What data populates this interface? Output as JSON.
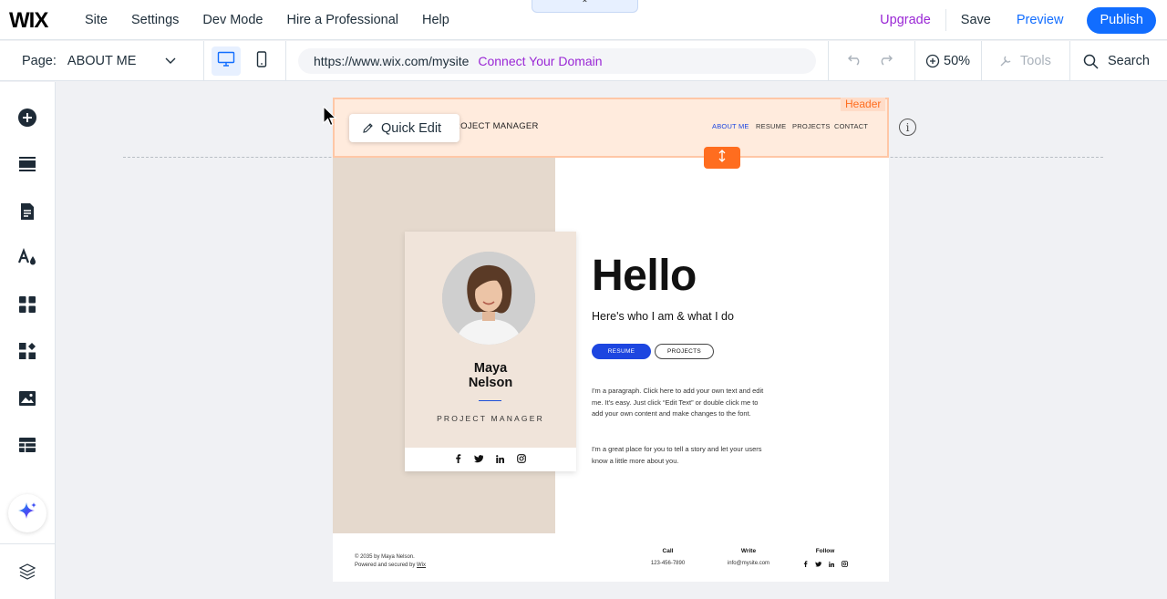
{
  "topbar": {
    "logo": "WIX",
    "menu": [
      "Site",
      "Settings",
      "Dev Mode",
      "Hire a Professional",
      "Help"
    ],
    "collapse_glyph": "⌃",
    "upgrade": "Upgrade",
    "save": "Save",
    "preview": "Preview",
    "publish": "Publish"
  },
  "toolbar": {
    "page_label": "Page:",
    "page_value": "ABOUT ME",
    "url": "https://www.wix.com/mysite",
    "connect_domain": "Connect Your Domain",
    "zoom": "50%",
    "tools": "Tools",
    "search": "Search"
  },
  "canvas": {
    "header_tag": "Header",
    "quick_edit": "Quick Edit",
    "header_role_partial": "ROJECT MANAGER",
    "nav": [
      "ABOUT ME",
      "RESUME",
      "PROJECTS",
      "CONTACT"
    ],
    "card": {
      "first_name": "Maya",
      "last_name": "Nelson",
      "role": "PROJECT MANAGER"
    },
    "hello": "Hello",
    "subtitle": "Here's who I am & what I do",
    "btn_resume": "RESUME",
    "btn_projects": "PROJECTS",
    "para1": "I'm a paragraph. Click here to add your own text and edit me. It's easy. Just click “Edit Text” or double click me to add your own content and make changes to the font.",
    "para2": "I'm a great place for you to tell a story and let your users know a little more about you.",
    "footer": {
      "copyright": "© 2035 by Maya Nelson.",
      "powered_prefix": "Powered and secured by",
      "powered_link": "Wix",
      "call_title": "Call",
      "call_value": "123-456-7890",
      "write_title": "Write",
      "write_value": "info@mysite.com",
      "follow_title": "Follow"
    }
  },
  "colors": {
    "accent": "#116dff",
    "upgrade": "#9a27d5",
    "header_select": "#ff6d1f",
    "resume_button": "#1d46e0"
  }
}
